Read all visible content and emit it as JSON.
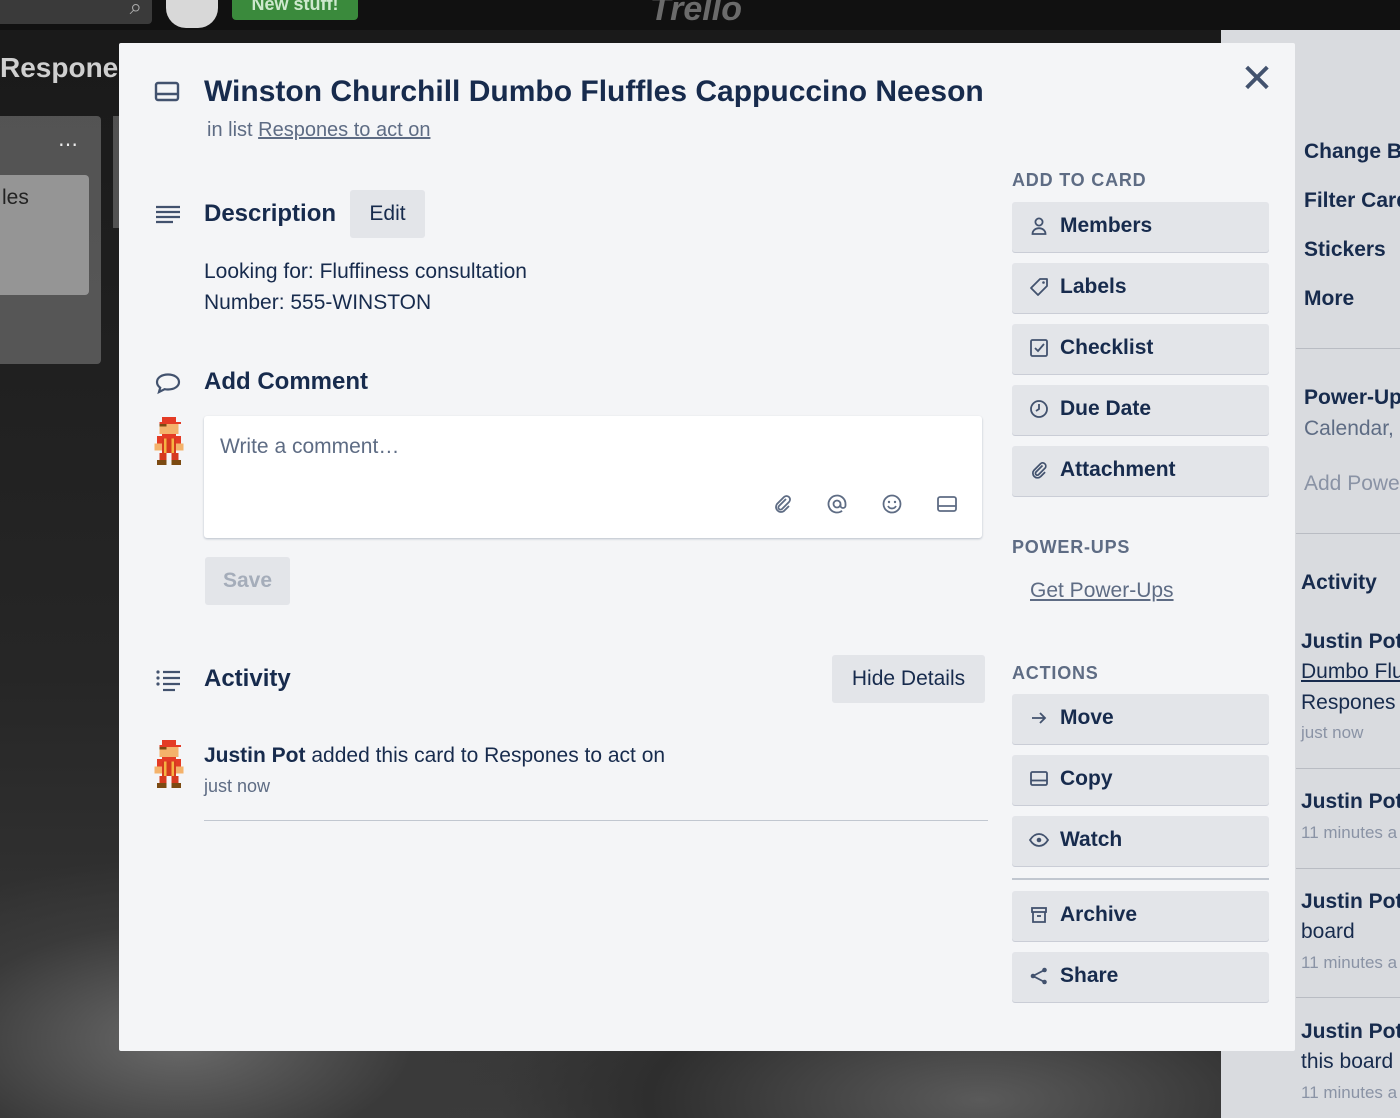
{
  "background": {
    "new_stuff_label": "New stuff!",
    "app_logo": "Trello",
    "board_title": "Respones",
    "list_card_text": "les"
  },
  "board_menu": {
    "items": [
      "Change B",
      "Filter Card",
      "Stickers",
      "More"
    ],
    "power_ups_title": "Power-Up",
    "power_ups_sub": "Calendar,",
    "add_power_ups": "Add Powe",
    "activity_title": "Activity",
    "activities": [
      {
        "name": "Justin Pot",
        "link": "Dumbo Flu",
        "text": "Respones",
        "time": "just now"
      },
      {
        "name": "Justin Pot",
        "time": "11 minutes a"
      },
      {
        "name": "Justin Pot",
        "text": "board",
        "time": "11 minutes a"
      },
      {
        "name": "Justin Pot",
        "text": "this board",
        "time": "11 minutes a"
      }
    ]
  },
  "card": {
    "title": "Winston Churchill Dumbo Fluffles Cappuccino Neeson",
    "in_list_prefix": "in list ",
    "list_name": "Respones to act on",
    "description": {
      "heading": "Description",
      "edit_label": "Edit",
      "lines": [
        "Looking for: Fluffiness consultation",
        "Number: 555-WINSTON"
      ]
    },
    "comment": {
      "heading": "Add Comment",
      "placeholder": "Write a comment…",
      "save_label": "Save"
    },
    "activity": {
      "heading": "Activity",
      "hide_details_label": "Hide Details",
      "entries": [
        {
          "user": "Justin Pot",
          "action": " added this card to Respones to act on",
          "time": "just now"
        }
      ]
    }
  },
  "sidebar": {
    "add_to_card_heading": "ADD TO CARD",
    "add_to_card": [
      {
        "label": "Members",
        "icon": "person-icon"
      },
      {
        "label": "Labels",
        "icon": "tag-icon"
      },
      {
        "label": "Checklist",
        "icon": "checkbox-icon"
      },
      {
        "label": "Due Date",
        "icon": "clock-icon"
      },
      {
        "label": "Attachment",
        "icon": "paperclip-icon"
      }
    ],
    "power_ups_heading": "POWER-UPS",
    "get_power_ups_label": "Get Power-Ups",
    "actions_heading": "ACTIONS",
    "actions": [
      {
        "label": "Move",
        "icon": "arrow-right-icon"
      },
      {
        "label": "Copy",
        "icon": "card-icon"
      },
      {
        "label": "Watch",
        "icon": "eye-icon"
      },
      {
        "label": "Archive",
        "icon": "archive-icon"
      },
      {
        "label": "Share",
        "icon": "share-icon"
      }
    ]
  }
}
